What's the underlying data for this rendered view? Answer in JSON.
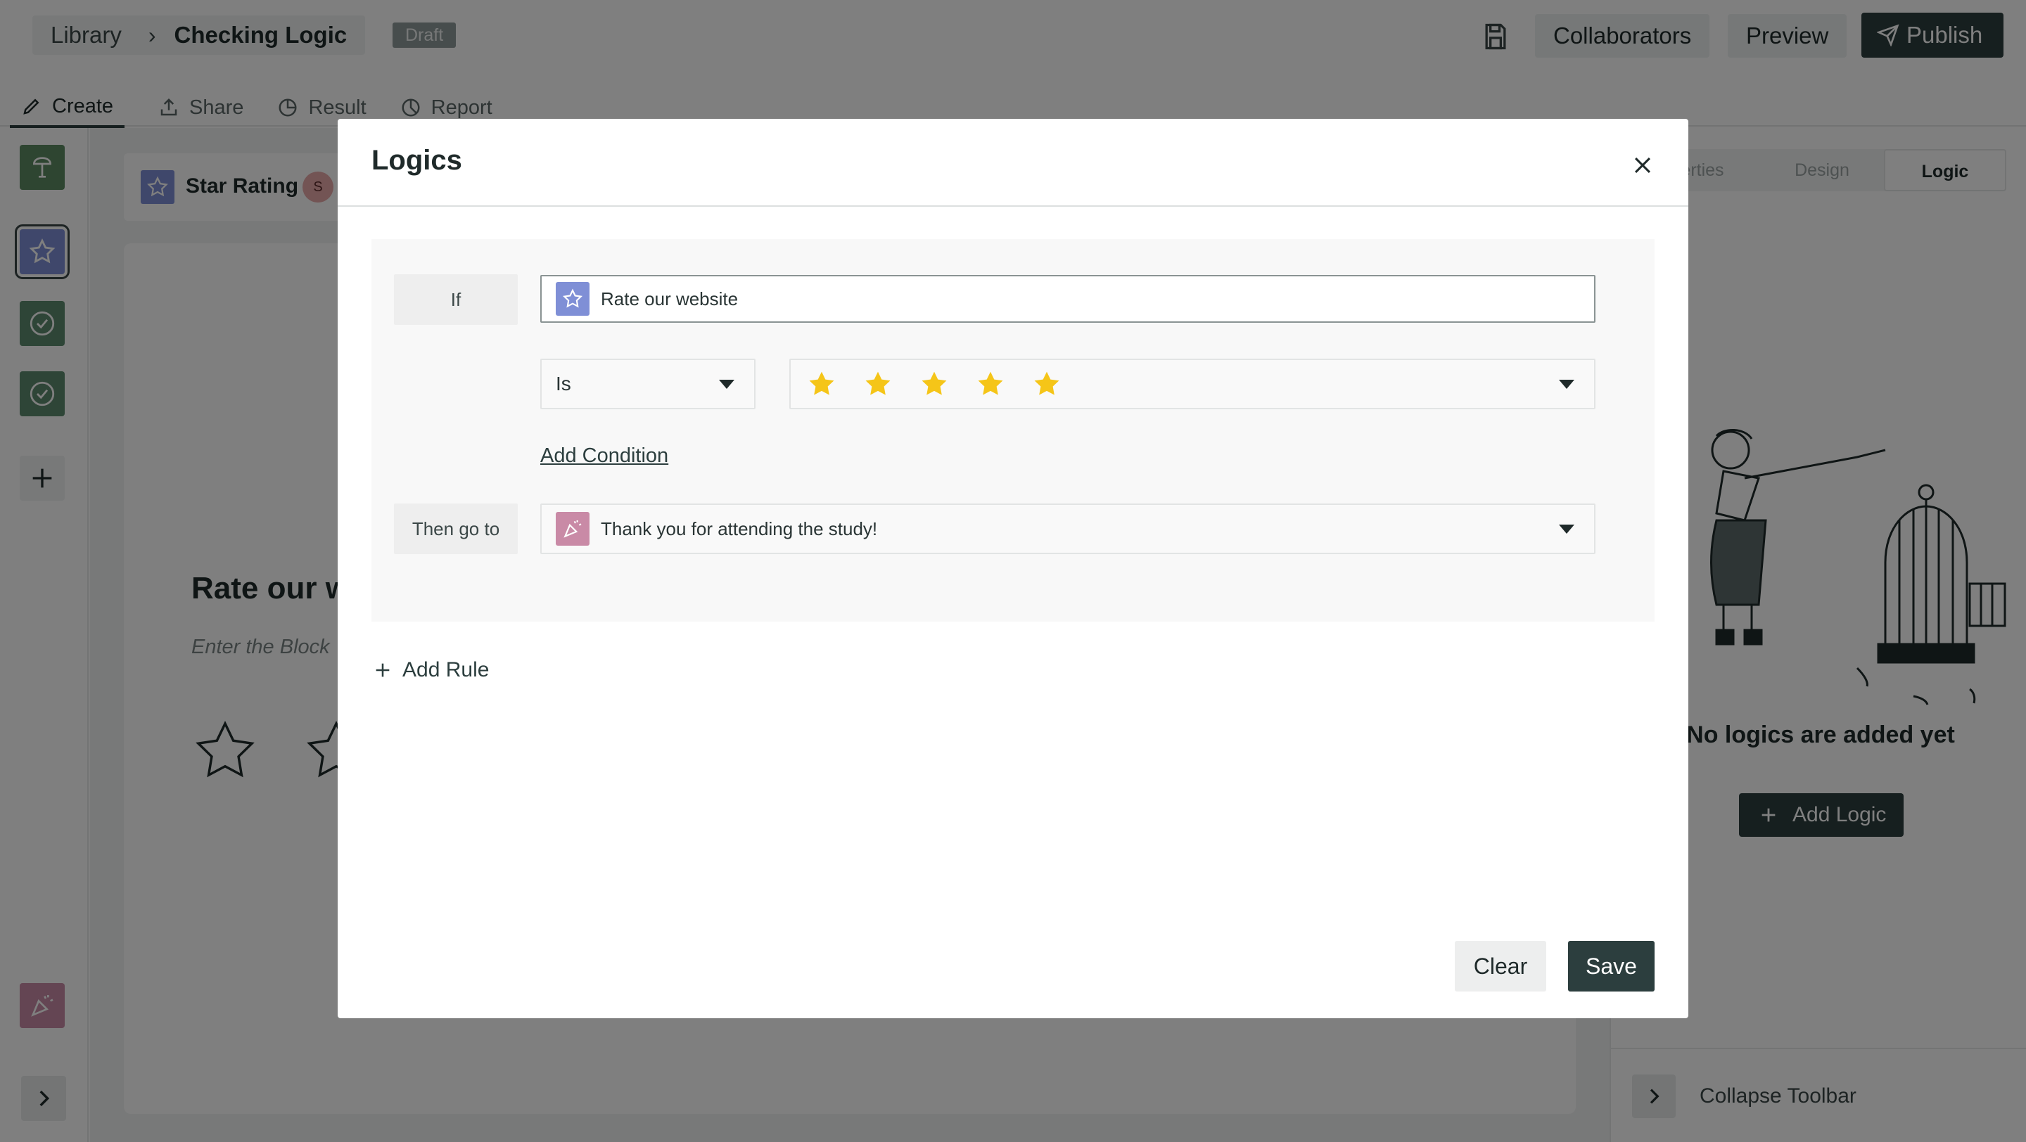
{
  "breadcrumb": {
    "root": "Library",
    "separator": "›",
    "current": "Checking Logic",
    "status": "Draft"
  },
  "header": {
    "collaborators": "Collaborators",
    "preview": "Preview",
    "publish": "Publish"
  },
  "tabs": [
    {
      "label": "Create",
      "icon": "pencil-icon"
    },
    {
      "label": "Share",
      "icon": "share-icon"
    },
    {
      "label": "Result",
      "icon": "pie-chart-icon"
    },
    {
      "label": "Report",
      "icon": "report-icon"
    }
  ],
  "block": {
    "type_label": "Star Rating",
    "avatar": "S",
    "title": "Rate our w",
    "description": "Enter the Block"
  },
  "right_panel": {
    "tabs": [
      "erties",
      "Design",
      "Logic"
    ],
    "empty_text": "No logics are added yet",
    "add_logic": "Add Logic",
    "collapse": "Collapse Toolbar"
  },
  "modal": {
    "title": "Logics",
    "if_label": "If",
    "if_field": "Rate our website",
    "operator": "Is",
    "rating_value": 5,
    "add_condition": "Add Condition",
    "then_label": "Then go to",
    "then_target": "Thank you for attending the study!",
    "add_rule": "Add Rule",
    "clear": "Clear",
    "save": "Save"
  },
  "colors": {
    "primary": "#2c3e3e",
    "star_icon_bg": "#7f8fd6",
    "thanks_icon_bg": "#c98aa6",
    "star_fill": "#f5c518"
  }
}
